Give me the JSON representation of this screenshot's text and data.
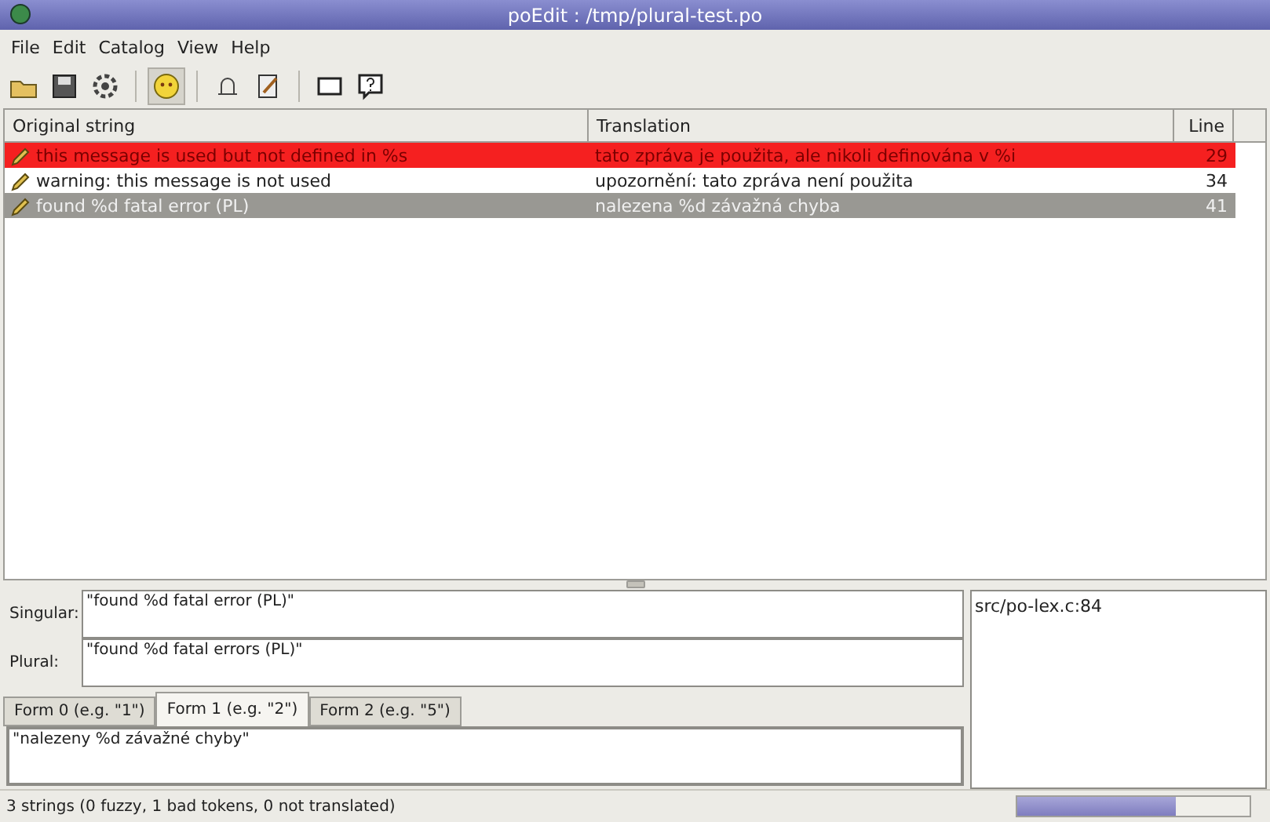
{
  "window": {
    "title": "poEdit : /tmp/plural-test.po"
  },
  "menu": [
    "File",
    "Edit",
    "Catalog",
    "View",
    "Help"
  ],
  "toolbar": [
    [
      {
        "kind": "open",
        "pressed": false
      },
      {
        "kind": "save",
        "pressed": false
      },
      {
        "kind": "settings",
        "pressed": false
      }
    ],
    [
      {
        "kind": "fuzzy",
        "pressed": true
      }
    ],
    [
      {
        "kind": "comment",
        "pressed": false
      },
      {
        "kind": "edit",
        "pressed": false
      }
    ],
    [
      {
        "kind": "window",
        "pressed": false
      },
      {
        "kind": "help",
        "pressed": false
      }
    ]
  ],
  "table": {
    "columns": [
      "Original string",
      "Translation",
      "Line"
    ],
    "rows": [
      {
        "error": true,
        "selected": false,
        "original": "this message is used but not defined in %s",
        "translation": "tato zpráva je použita, ale nikoli definována v %i",
        "line": "29"
      },
      {
        "error": false,
        "selected": false,
        "original": "warning: this message is not used",
        "translation": "upozornění: tato zpráva není použita",
        "line": "34"
      },
      {
        "error": false,
        "selected": true,
        "original": "found %d fatal error (PL)",
        "translation": "nalezena %d závažná chyba",
        "line": "41"
      }
    ]
  },
  "source": {
    "singular_label": "Singular:",
    "singular": "\"found %d fatal error (PL)\"",
    "plural_label": "Plural:",
    "plural": "\"found %d fatal errors (PL)\""
  },
  "forms": [
    {
      "label": "Form 0 (e.g. \"1\")",
      "selected": false
    },
    {
      "label": "Form 1 (e.g. \"2\")",
      "selected": true
    },
    {
      "label": "Form 2 (e.g. \"5\")",
      "selected": false
    }
  ],
  "translation_value": "\"nalezeny %d závažné chyby\"",
  "references": [
    "src/po-lex.c:84"
  ],
  "status_bar": {
    "text": "3 strings (0 fuzzy, 1 bad tokens, 0 not translated)",
    "level": 0.68
  }
}
